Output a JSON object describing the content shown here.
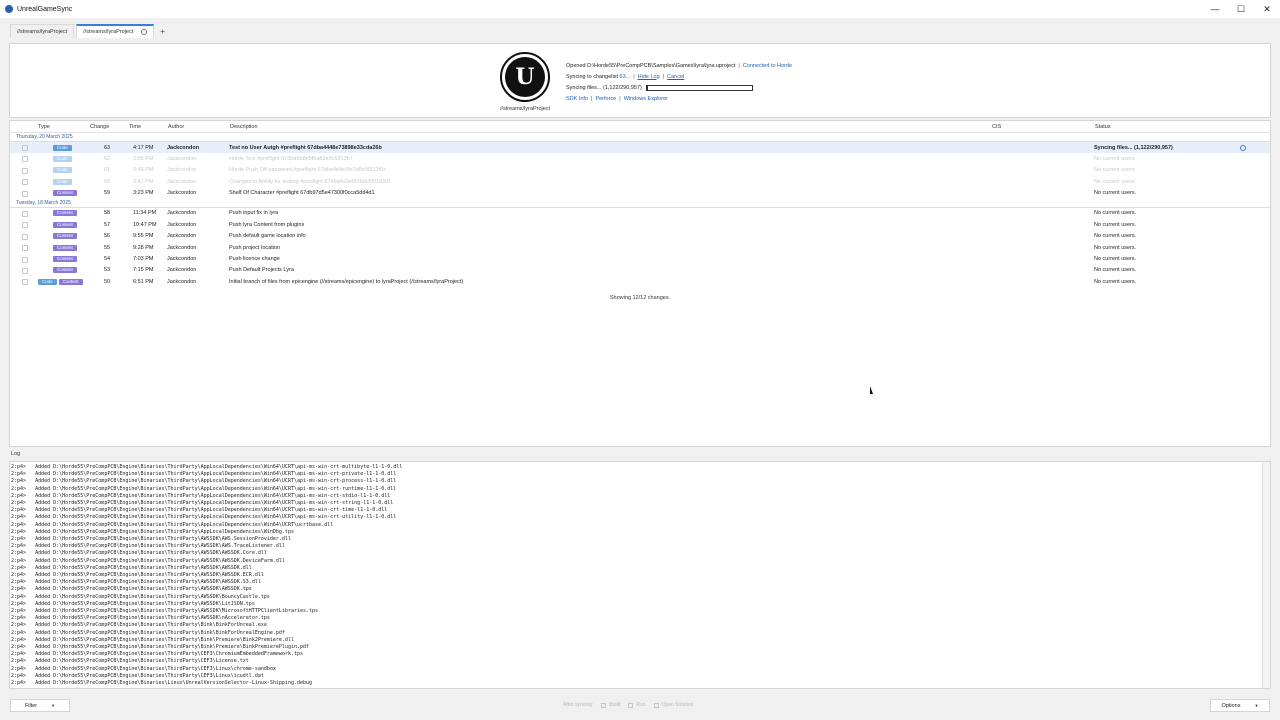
{
  "window": {
    "title": "UnrealGameSync",
    "controls": [
      "—",
      "☐",
      "✕"
    ]
  },
  "tabs": [
    {
      "label": "//streams/lyraProject"
    },
    {
      "label": "//streams/lyraProject"
    }
  ],
  "tab_add": "+",
  "header": {
    "logo_glyph": "U",
    "stream_label": "//streams/lyraProject",
    "opened_prefix": "Opened",
    "project_path": "D:\\Horde55\\PreCompPCB\\Samples\\Games\\lyra\\lyra.uproject",
    "connected_link": "Connected to Horde",
    "syncing_prefix": "Syncing to changelist",
    "syncing_changelist": "63...",
    "hide_log_link": "Hide Log",
    "cancel_link": "Cancel",
    "syncing_files": "Syncing files... (1,122/290,957)",
    "progress_fraction": 0.004,
    "links": [
      "SDK Info",
      "Perforce",
      "Windows Explorer"
    ],
    "separator": "|"
  },
  "columns": {
    "type": "Type",
    "change": "Change",
    "time": "Time",
    "author": "Author",
    "description": "Description",
    "cis": "CIS",
    "status": "Status"
  },
  "groups": [
    {
      "date": "Thursday, 20 March 2025",
      "rows": [
        {
          "tags": [
            "Code"
          ],
          "change": "63",
          "time": "4:17 PM",
          "author": "Jackcondon",
          "description": "Test no User Autgh #preflight 67dba4448e73898e33cda26b",
          "status": "Syncing files... (1,122/290,957)",
          "selected": true,
          "bold": true,
          "faded": false
        },
        {
          "tags": [
            "Code"
          ],
          "change": "62",
          "time": "3:55 PM",
          "author": "Jackcondon",
          "description": "Horde Test #preflight 67dba6b8e5f6a82e3c5313b7",
          "status": "No current users",
          "selected": false,
          "bold": false,
          "faded": true
        },
        {
          "tags": [
            "Code"
          ],
          "change": "61",
          "time": "3:46 PM",
          "author": "Jackcondon",
          "description": "Horde Push Off password #preflight 67dba4e8e5fe2d8e5f313f0c",
          "status": "No current users",
          "selected": false,
          "bold": false,
          "faded": true
        },
        {
          "tags": [
            "Code"
          ],
          "change": "60",
          "time": "3:41 PM",
          "author": "Jackcondon",
          "description": "Changes to Ability for testing #preflight 67dba4a3e5f3b9c5f3162d1",
          "status": "No current users",
          "selected": false,
          "bold": false,
          "faded": true
        },
        {
          "tags": [
            "Content"
          ],
          "change": "59",
          "time": "3:23 PM",
          "author": "Jackcondon",
          "description": "Shelf Of Character #preflight 67db97d5e47300f0cca5dd4d1",
          "status": "No current users.",
          "selected": false,
          "bold": false,
          "faded": false
        }
      ]
    },
    {
      "date": "Tuesday, 18 March 2025",
      "rows": [
        {
          "tags": [
            "Content"
          ],
          "change": "58",
          "time": "11:34 PM",
          "author": "Jackcondon",
          "description": "Push input fix in lyra",
          "status": "No current users.",
          "selected": false,
          "bold": false,
          "faded": false
        },
        {
          "tags": [
            "Content"
          ],
          "change": "57",
          "time": "10:47 PM",
          "author": "Jackcondon",
          "description": "Push lyra Content from plugins",
          "status": "No current users.",
          "selected": false,
          "bold": false,
          "faded": false
        },
        {
          "tags": [
            "Content"
          ],
          "change": "56",
          "time": "9:55 PM",
          "author": "Jackcondon",
          "description": "Push default game location info",
          "status": "No current users.",
          "selected": false,
          "bold": false,
          "faded": false
        },
        {
          "tags": [
            "Content"
          ],
          "change": "55",
          "time": "9:28 PM",
          "author": "Jackcondon",
          "description": "Push project location",
          "status": "No current users.",
          "selected": false,
          "bold": false,
          "faded": false
        },
        {
          "tags": [
            "Content"
          ],
          "change": "54",
          "time": "7:03 PM",
          "author": "Jackcondon",
          "description": "Push licence change",
          "status": "No current users.",
          "selected": false,
          "bold": false,
          "faded": false
        },
        {
          "tags": [
            "Content"
          ],
          "change": "53",
          "time": "7:15 PM",
          "author": "Jackcondon",
          "description": "Push Default Projects Lyra",
          "status": "No current users.",
          "selected": false,
          "bold": false,
          "faded": false
        },
        {
          "tags": [
            "Code",
            "Content"
          ],
          "change": "50",
          "time": "6:51 PM",
          "author": "Jackcondon",
          "description": "Initial branch of files from epicengine (//streams/epicengine) to lyraProject (//streams/lyraProject)",
          "status": "No current users.",
          "selected": false,
          "bold": false,
          "faded": false
        }
      ]
    }
  ],
  "showing": "Showing 12/12 changes.",
  "log": {
    "label": "Log",
    "lines": [
      "2:p4>   Added D:\\Horde55\\PreCompPCB\\Engine\\Binaries\\ThirdParty\\AppLocalDependencies\\Win64\\UCRT\\api-ms-win-crt-multibyte-l1-1-0.dll",
      "2:p4>   Added D:\\Horde55\\PreCompPCB\\Engine\\Binaries\\ThirdParty\\AppLocalDependencies\\Win64\\UCRT\\api-ms-win-crt-private-l1-1-0.dll",
      "2:p4>   Added D:\\Horde55\\PreCompPCB\\Engine\\Binaries\\ThirdParty\\AppLocalDependencies\\Win64\\UCRT\\api-ms-win-crt-process-l1-1-0.dll",
      "2:p4>   Added D:\\Horde55\\PreCompPCB\\Engine\\Binaries\\ThirdParty\\AppLocalDependencies\\Win64\\UCRT\\api-ms-win-crt-runtime-l1-1-0.dll",
      "2:p4>   Added D:\\Horde55\\PreCompPCB\\Engine\\Binaries\\ThirdParty\\AppLocalDependencies\\Win64\\UCRT\\api-ms-win-crt-stdio-l1-1-0.dll",
      "2:p4>   Added D:\\Horde55\\PreCompPCB\\Engine\\Binaries\\ThirdParty\\AppLocalDependencies\\Win64\\UCRT\\api-ms-win-crt-string-l1-1-0.dll",
      "2:p4>   Added D:\\Horde55\\PreCompPCB\\Engine\\Binaries\\ThirdParty\\AppLocalDependencies\\Win64\\UCRT\\api-ms-win-crt-time-l1-1-0.dll",
      "2:p4>   Added D:\\Horde55\\PreCompPCB\\Engine\\Binaries\\ThirdParty\\AppLocalDependencies\\Win64\\UCRT\\api-ms-win-crt-utility-l1-1-0.dll",
      "2:p4>   Added D:\\Horde55\\PreCompPCB\\Engine\\Binaries\\ThirdParty\\AppLocalDependencies\\Win64\\UCRT\\ucrtbase.dll",
      "2:p4>   Added D:\\Horde55\\PreCompPCB\\Engine\\Binaries\\ThirdParty\\AppLocalDependencies\\WinDbg.tps",
      "2:p4>   Added D:\\Horde55\\PreCompPCB\\Engine\\Binaries\\ThirdParty\\AWSSDK\\AWS.SessionProvider.dll",
      "2:p4>   Added D:\\Horde55\\PreCompPCB\\Engine\\Binaries\\ThirdParty\\AWSSDK\\AWS.TraceListener.dll",
      "2:p4>   Added D:\\Horde55\\PreCompPCB\\Engine\\Binaries\\ThirdParty\\AWSSDK\\AWSSDK.Core.dll",
      "2:p4>   Added D:\\Horde55\\PreCompPCB\\Engine\\Binaries\\ThirdParty\\AWSSDK\\AWSSDK.DeviceFarm.dll",
      "2:p4>   Added D:\\Horde55\\PreCompPCB\\Engine\\Binaries\\ThirdParty\\AWSSDK\\AWSSDK.dll",
      "2:p4>   Added D:\\Horde55\\PreCompPCB\\Engine\\Binaries\\ThirdParty\\AWSSDK\\AWSSDK.ECR.dll",
      "2:p4>   Added D:\\Horde55\\PreCompPCB\\Engine\\Binaries\\ThirdParty\\AWSSDK\\AWSSDK.S3.dll",
      "2:p4>   Added D:\\Horde55\\PreCompPCB\\Engine\\Binaries\\ThirdParty\\AWSSDK\\AWSSDK.tps",
      "2:p4>   Added D:\\Horde55\\PreCompPCB\\Engine\\Binaries\\ThirdParty\\AWSSDK\\BouncyCastle.tps",
      "2:p4>   Added D:\\Horde55\\PreCompPCB\\Engine\\Binaries\\ThirdParty\\AWSSDK\\LitJSON.tps",
      "2:p4>   Added D:\\Horde55\\PreCompPCB\\Engine\\Binaries\\ThirdParty\\AWSSDK\\MicrosoftHTTPClientLibraries.tps",
      "2:p4>   Added D:\\Horde55\\PreCompPCB\\Engine\\Binaries\\ThirdParty\\AWSSDK\\nAccelerator.tps",
      "2:p4>   Added D:\\Horde55\\PreCompPCB\\Engine\\Binaries\\ThirdParty\\Bink\\BinkForUnreal.exe",
      "2:p4>   Added D:\\Horde55\\PreCompPCB\\Engine\\Binaries\\ThirdParty\\Bink\\BinkForUnrealEngine.pdf",
      "2:p4>   Added D:\\Horde55\\PreCompPCB\\Engine\\Binaries\\ThirdParty\\Bink\\Premiere\\Bink2Premiere.dll",
      "2:p4>   Added D:\\Horde55\\PreCompPCB\\Engine\\Binaries\\ThirdParty\\Bink\\Premiere\\BinkPremierePlugin.pdf",
      "2:p4>   Added D:\\Horde55\\PreCompPCB\\Engine\\Binaries\\ThirdParty\\CEF3\\ChromiumEmbeddedFramework.tps",
      "2:p4>   Added D:\\Horde55\\PreCompPCB\\Engine\\Binaries\\ThirdParty\\CEF3\\License.txt",
      "2:p4>   Added D:\\Horde55\\PreCompPCB\\Engine\\Binaries\\ThirdParty\\CEF3\\Linux\\chrome-sandbox",
      "2:p4>   Added D:\\Horde55\\PreCompPCB\\Engine\\Binaries\\ThirdParty\\CEF3\\Linux\\icudtl.dat",
      "2:p4>   Added D:\\Horde55\\PreCompPCB\\Engine\\Binaries\\Linux\\UnrealVersionSelector-Linux-Shipping.debug"
    ]
  },
  "bottom": {
    "filter_label": "Filter",
    "after_sync_label": "After syncing:",
    "build_label": "Build",
    "run_label": "Run",
    "open_solution_label": "Open Solution",
    "options_label": "Options"
  }
}
